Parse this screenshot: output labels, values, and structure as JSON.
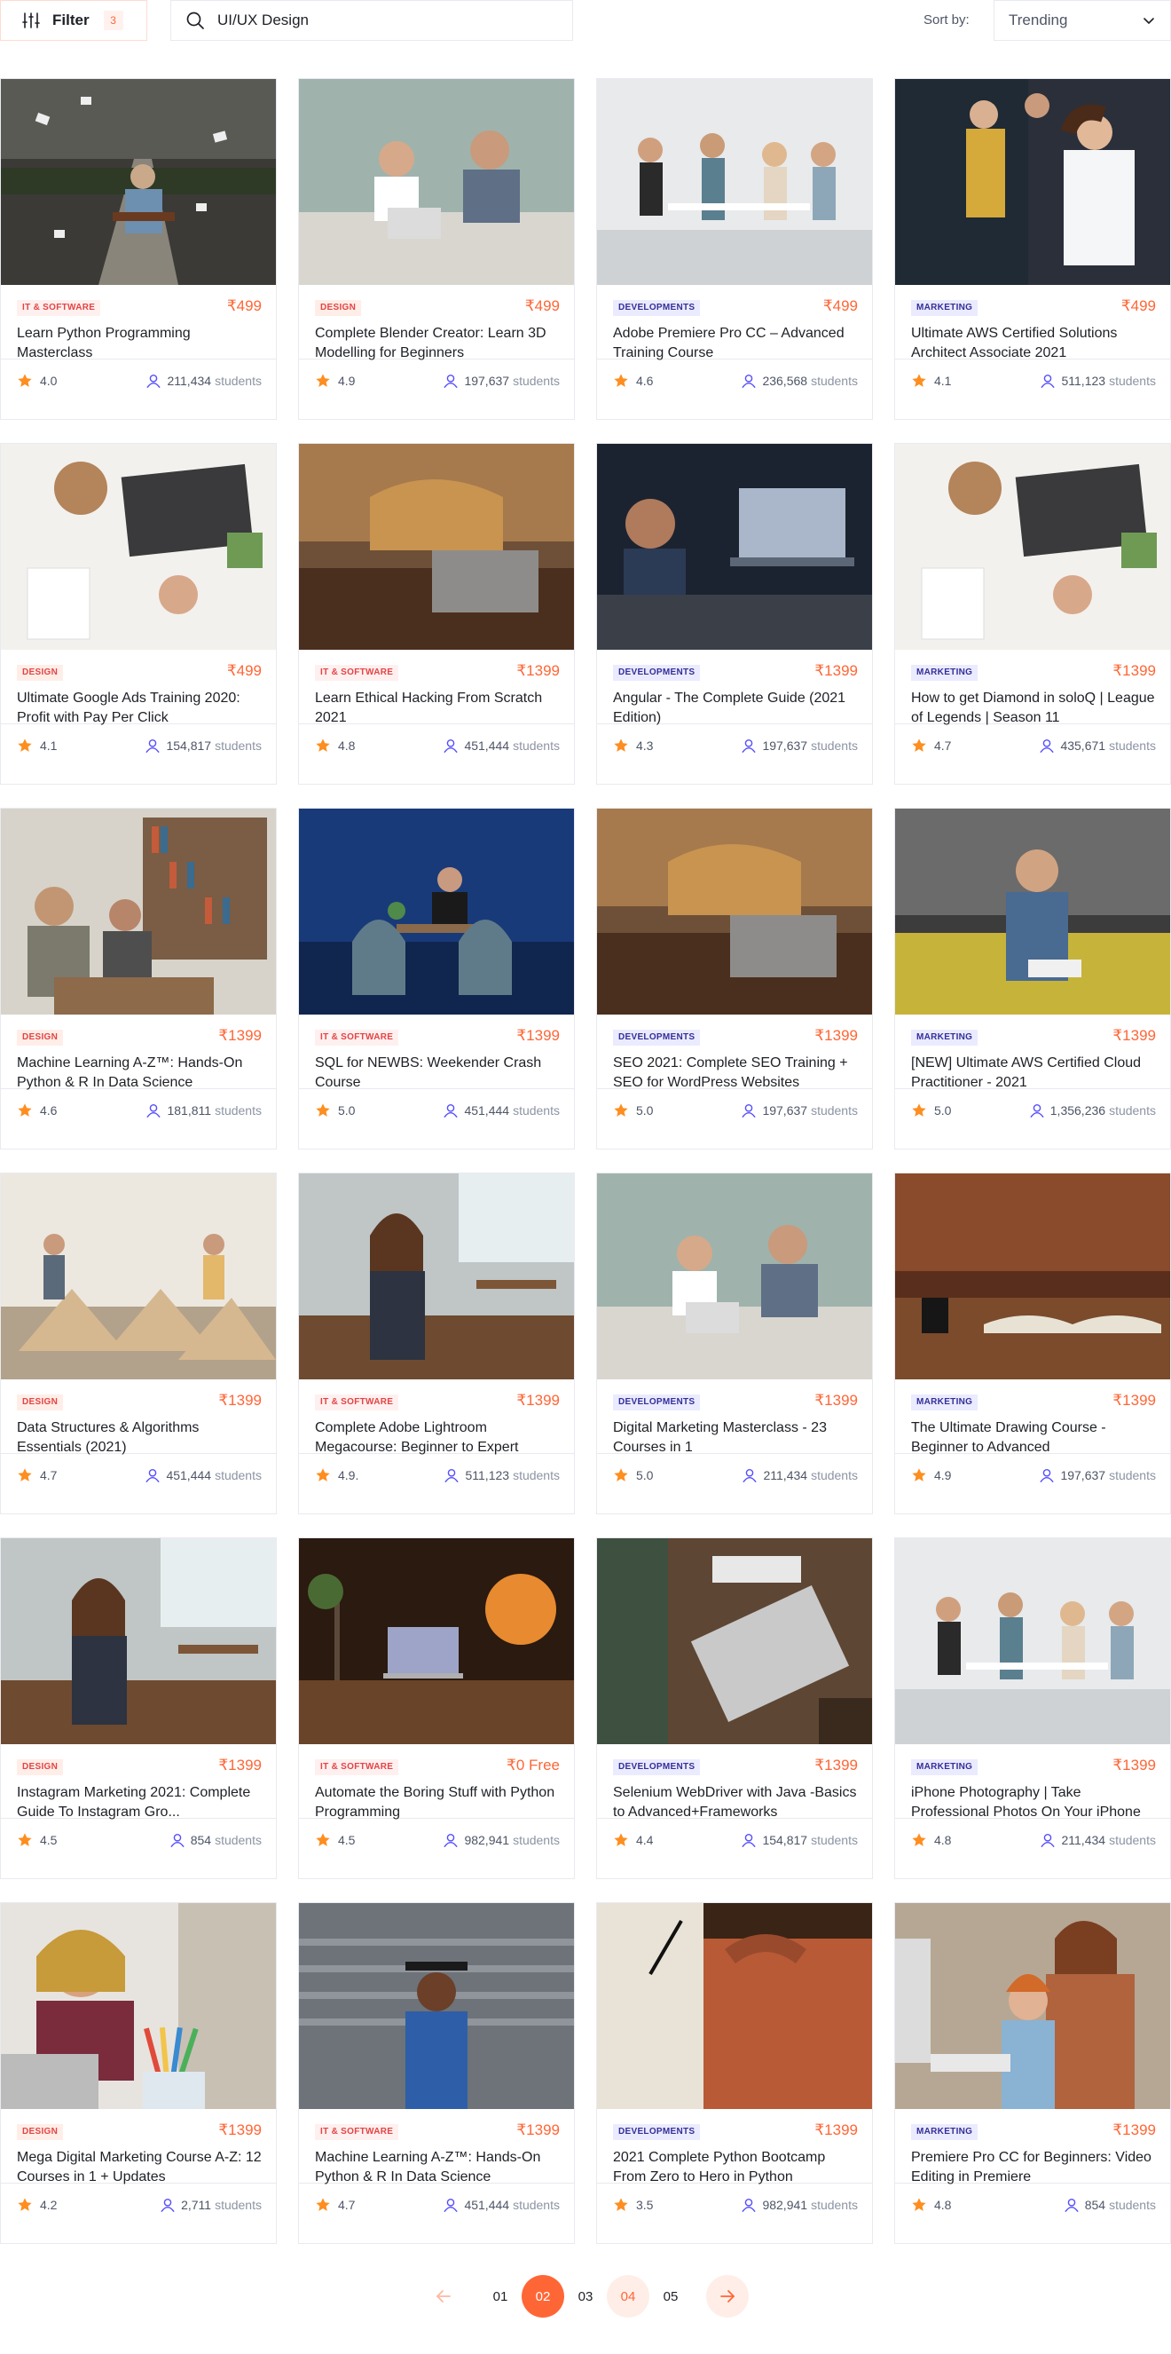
{
  "toolbar": {
    "filter_label": "Filter",
    "filter_count": "3",
    "search_value": "UI/UX Design",
    "sort_label": "Sort by:",
    "sort_value": "Trending"
  },
  "colors": {
    "accent": "#ff6636",
    "star": "#fd8e1f",
    "students_icon": "#564ffd",
    "IT & SOFTWARE": {
      "bg": "#fff0f0",
      "fg": "#e34444"
    },
    "DESIGN": {
      "bg": "#ffeee8",
      "fg": "#e34444"
    },
    "DEVELOPMENTS": {
      "bg": "#ebebff",
      "fg": "#342f98"
    },
    "MARKETING": {
      "bg": "#ebebff",
      "fg": "#342f98"
    }
  },
  "courses": [
    {
      "category": "IT & SOFTWARE",
      "price": "₹499",
      "title": "Learn Python Programming Masterclass",
      "rating": "4.0",
      "students": "211,434",
      "scene": "outdoor-road"
    },
    {
      "category": "DESIGN",
      "price": "₹499",
      "title": "Complete Blender Creator: Learn 3D Modelling for Beginners",
      "rating": "4.9",
      "students": "197,637",
      "scene": "meeting"
    },
    {
      "category": "DEVELOPMENTS",
      "price": "₹499",
      "title": "Adobe Premiere Pro CC – Advanced Training Course",
      "rating": "4.6",
      "students": "236,568",
      "scene": "office-bright"
    },
    {
      "category": "MARKETING",
      "price": "₹499",
      "title": "Ultimate AWS Certified Solutions Architect Associate 2021",
      "rating": "4.1",
      "students": "511,123",
      "scene": "board"
    },
    {
      "category": "DESIGN",
      "price": "₹499",
      "title": "Ultimate Google Ads Training 2020: Profit with Pay Per Click",
      "rating": "4.1",
      "students": "154,817",
      "scene": "desk-white"
    },
    {
      "category": "IT & SOFTWARE",
      "price": "₹1399",
      "title": "Learn Ethical Hacking From Scratch 2021",
      "rating": "4.8",
      "students": "451,444",
      "scene": "laptop-warm"
    },
    {
      "category": "DEVELOPMENTS",
      "price": "₹1399",
      "title": "Angular - The Complete Guide (2021 Edition)",
      "rating": "4.3",
      "students": "197,637",
      "scene": "laptop-dark"
    },
    {
      "category": "MARKETING",
      "price": "₹1399",
      "title": "How to get Diamond in soloQ | League of Legends | Season 11",
      "rating": "4.7",
      "students": "435,671",
      "scene": "desk-white"
    },
    {
      "category": "DESIGN",
      "price": "₹1399",
      "title": "Machine Learning A-Z™: Hands-On Python & R In Data Science",
      "rating": "4.6",
      "students": "181,811",
      "scene": "library"
    },
    {
      "category": "IT & SOFTWARE",
      "price": "₹1399",
      "title": "SQL for NEWBS: Weekender Crash Course",
      "rating": "5.0",
      "students": "451,444",
      "scene": "blue-room"
    },
    {
      "category": "DEVELOPMENTS",
      "price": "₹1399",
      "title": "SEO 2021: Complete SEO Training + SEO for WordPress Websites",
      "rating": "5.0",
      "students": "197,637",
      "scene": "laptop-warm"
    },
    {
      "category": "MARKETING",
      "price": "₹1399",
      "title": "[NEW] Ultimate AWS Certified Cloud Practitioner - 2021",
      "rating": "5.0",
      "students": "1,356,236",
      "scene": "sofa"
    },
    {
      "category": "DESIGN",
      "price": "₹1399",
      "title": "Data Structures & Algorithms Essentials (2021)",
      "rating": "4.7",
      "students": "451,444",
      "scene": "classroom"
    },
    {
      "category": "IT & SOFTWARE",
      "price": "₹1399",
      "title": "Complete Adobe Lightroom Megacourse: Beginner to Expert",
      "rating": "4.9.",
      "students": "511,123",
      "scene": "cafe"
    },
    {
      "category": "DEVELOPMENTS",
      "price": "₹1399",
      "title": "Digital Marketing Masterclass - 23 Courses in 1",
      "rating": "5.0",
      "students": "211,434",
      "scene": "meeting"
    },
    {
      "category": "MARKETING",
      "price": "₹1399",
      "title": "The Ultimate Drawing Course - Beginner to Advanced",
      "rating": "4.9",
      "students": "197,637",
      "scene": "book-blur"
    },
    {
      "category": "DESIGN",
      "price": "₹1399",
      "title": "Instagram Marketing 2021: Complete Guide To Instagram Gro...",
      "rating": "4.5",
      "students": "854",
      "scene": "cafe"
    },
    {
      "category": "IT & SOFTWARE",
      "price": "₹0 Free",
      "title": "Automate the Boring Stuff with Python Programming",
      "rating": "4.5",
      "students": "982,941",
      "scene": "night-desk"
    },
    {
      "category": "DEVELOPMENTS",
      "price": "₹1399",
      "title": "Selenium WebDriver with Java -Basics to Advanced+Frameworks",
      "rating": "4.4",
      "students": "154,817",
      "scene": "laptop-wood"
    },
    {
      "category": "MARKETING",
      "price": "₹1399",
      "title": "iPhone Photography | Take Professional Photos On Your iPhone",
      "rating": "4.8",
      "students": "211,434",
      "scene": "office-bright"
    },
    {
      "category": "DESIGN",
      "price": "₹1399",
      "title": "Mega Digital Marketing Course A-Z: 12 Courses in 1 + Updates",
      "rating": "4.2",
      "students": "2,711",
      "scene": "pencils"
    },
    {
      "category": "IT & SOFTWARE",
      "price": "₹1399",
      "title": "Machine Learning A-Z™: Hands-On Python & R In Data Science",
      "rating": "4.7",
      "students": "451,444",
      "scene": "stadium"
    },
    {
      "category": "DEVELOPMENTS",
      "price": "₹1399",
      "title": "2021 Complete Python Bootcamp From Zero to Hero in Python",
      "rating": "3.5",
      "students": "982,941",
      "scene": "writing"
    },
    {
      "category": "MARKETING",
      "price": "₹1399",
      "title": "Premiere Pro CC for Beginners: Video Editing in Premiere",
      "rating": "4.8",
      "students": "854",
      "scene": "home-pc"
    }
  ],
  "students_word": "students",
  "pagination": {
    "pages": [
      "01",
      "02",
      "03",
      "04",
      "05"
    ],
    "active": "02",
    "highlighted": "04"
  }
}
